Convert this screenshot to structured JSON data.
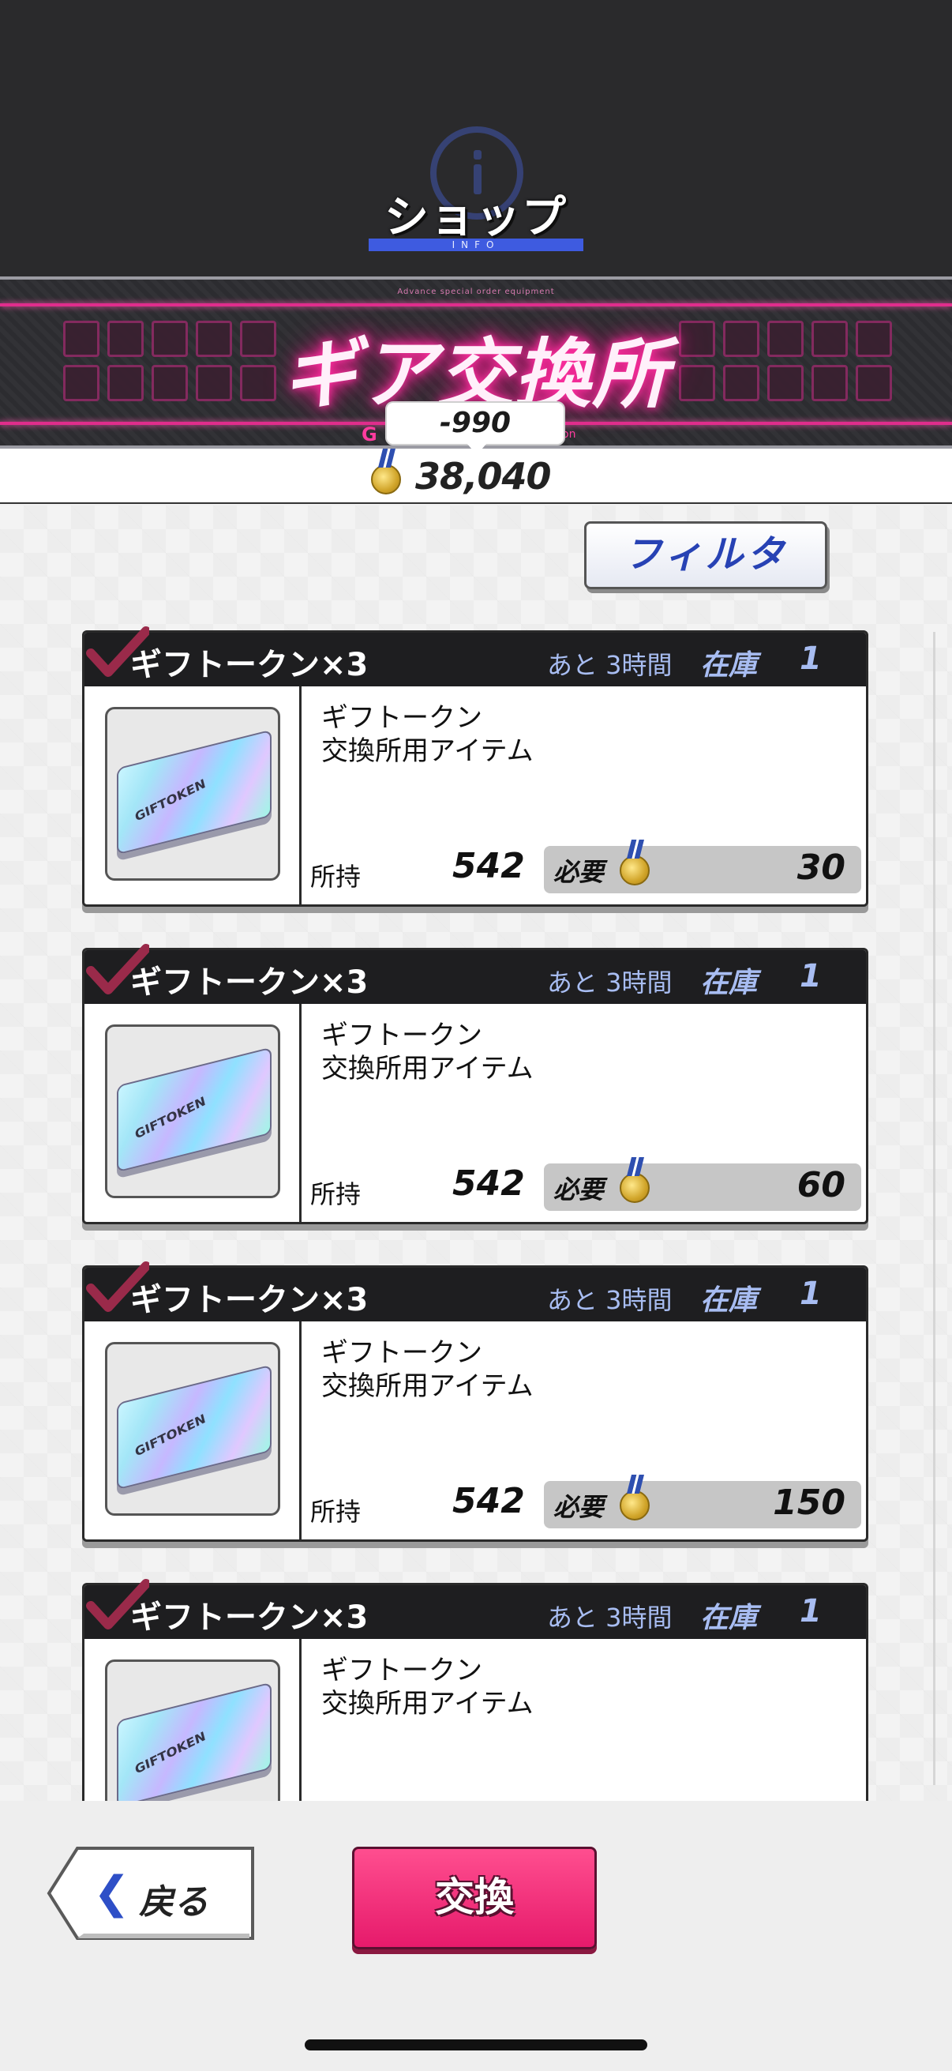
{
  "header": {
    "title": "ショップ",
    "subtitle": "INFO"
  },
  "banner": {
    "small_text": "Advance special order equipment",
    "title": "ギア交換所",
    "left_letter": "G",
    "right_fragment": "on"
  },
  "currency": {
    "delta": "-990",
    "amount": "38,040",
    "icon": "medal-icon"
  },
  "filter": {
    "label": "フィルタ"
  },
  "items": [
    {
      "name": "ギフトークン×3",
      "remaining": "あと 3時間",
      "stock_label": "在庫",
      "stock": "1",
      "desc_line1": "ギフトークン",
      "desc_line2": "交換所用アイテム",
      "owned_label": "所持",
      "owned": "542",
      "need_label": "必要",
      "need": "30",
      "token_text": "GIFTOKEN"
    },
    {
      "name": "ギフトークン×3",
      "remaining": "あと 3時間",
      "stock_label": "在庫",
      "stock": "1",
      "desc_line1": "ギフトークン",
      "desc_line2": "交換所用アイテム",
      "owned_label": "所持",
      "owned": "542",
      "need_label": "必要",
      "need": "60",
      "token_text": "GIFTOKEN"
    },
    {
      "name": "ギフトークン×3",
      "remaining": "あと 3時間",
      "stock_label": "在庫",
      "stock": "1",
      "desc_line1": "ギフトークン",
      "desc_line2": "交換所用アイテム",
      "owned_label": "所持",
      "owned": "542",
      "need_label": "必要",
      "need": "150",
      "token_text": "GIFTOKEN"
    },
    {
      "name": "ギフトークン×3",
      "remaining": "あと 3時間",
      "stock_label": "在庫",
      "stock": "1",
      "desc_line1": "ギフトークン",
      "desc_line2": "交換所用アイテム",
      "token_text": "GIFTOKEN"
    }
  ],
  "footer": {
    "back_label": "戻る",
    "exchange_label": "交換"
  },
  "colors": {
    "accent_pink": "#e61a6b",
    "accent_blue": "#2742b4",
    "header_bg": "#2a2a2c"
  }
}
